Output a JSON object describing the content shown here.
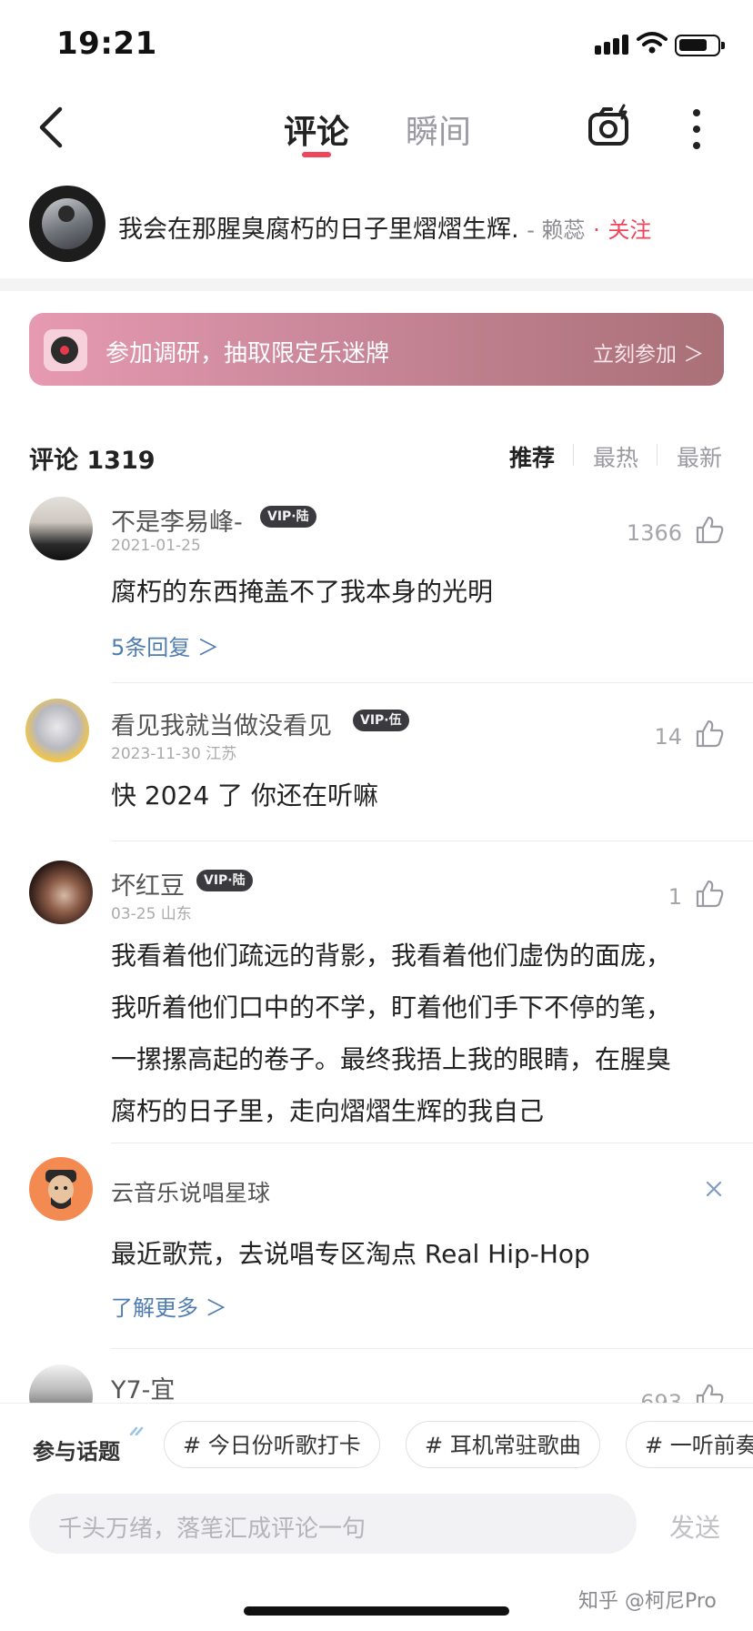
{
  "status": {
    "time": "19:21"
  },
  "header": {
    "tabs": [
      {
        "label": "评论",
        "active": true
      },
      {
        "label": "瞬间",
        "active": false
      }
    ]
  },
  "song": {
    "title": "我会在那腥臭腐朽的日子里熠熠生辉.",
    "artist": "- 赖蕊",
    "follow_prefix": "·",
    "follow_label": "关注"
  },
  "banner": {
    "text": "参加调研，抽取限定乐迷牌",
    "cta": "立刻参加 ＞"
  },
  "comments_header": {
    "count_label": "评论 1319",
    "sort": [
      "推荐",
      "最热",
      "最新"
    ]
  },
  "comments": [
    {
      "username": "不是李易峰-",
      "badge": "VIP·陆",
      "date": "2021-01-25",
      "likes": "1366",
      "text": "腐朽的东西掩盖不了我本身的光明",
      "replies": "5条回复 ＞"
    },
    {
      "username": "看见我就当做没看见",
      "badge": "VIP·伍",
      "date": "2023-11-30 江苏",
      "likes": "14",
      "text": "快 2024 了 你还在听嘛"
    },
    {
      "username": "坏红豆",
      "badge": "VIP·陆",
      "date": "03-25 山东",
      "likes": "1",
      "text_lines": [
        "我看着他们疏远的背影，我看着他们虚伪的面庞，",
        "我听着他们口中的不学，盯着他们手下不停的笔，",
        "一摞摞高起的卷子。最终我捂上我的眼睛，在腥臭",
        "腐朽的日子里，走向熠熠生辉的我自己"
      ]
    }
  ],
  "promo": {
    "name": "云音乐说唱星球",
    "text": "最近歌荒，去说唱专区淘点 Real Hip-Hop",
    "link": "了解更多 ＞"
  },
  "partial_comment": {
    "username": "Y7-宜",
    "likes": "693"
  },
  "topics": {
    "title": "参与话题",
    "chips": [
      "# 今日份听歌打卡",
      "# 耳机常驻歌曲",
      "# 一听前奏"
    ]
  },
  "composer": {
    "placeholder": "千头万绪，落笔汇成评论一句",
    "send": "发送"
  },
  "watermark": "知乎 @柯尼Pro",
  "colors": {
    "accent": "#f0445a",
    "link": "#507daf"
  }
}
